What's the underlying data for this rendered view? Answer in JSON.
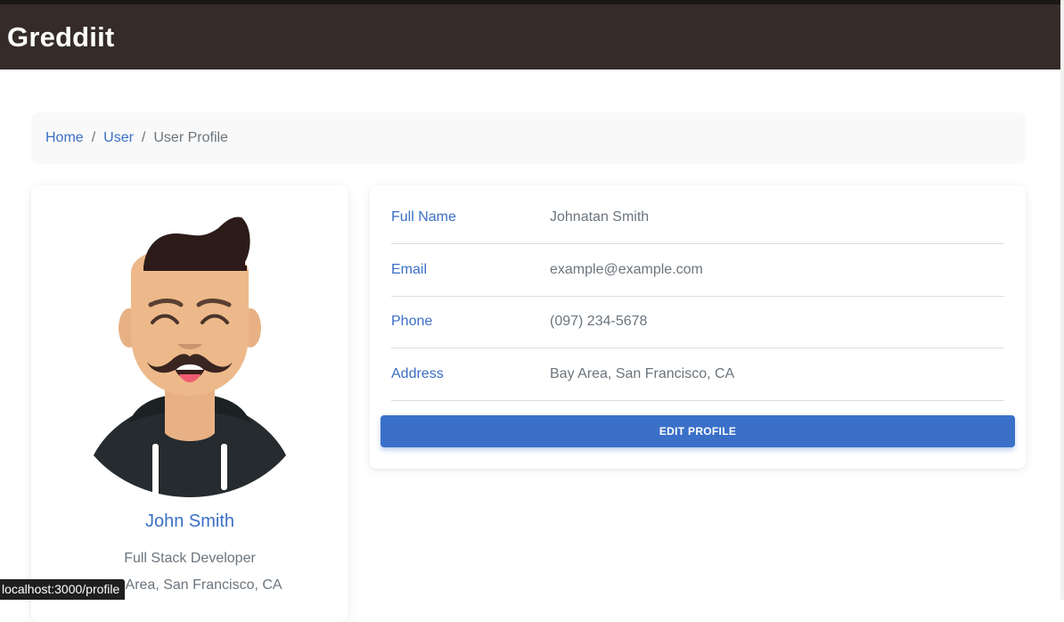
{
  "app": {
    "brand": "Greddiit"
  },
  "breadcrumb": {
    "home": "Home",
    "separator": "/",
    "user": "User",
    "current": "User Profile"
  },
  "profile": {
    "name": "John Smith",
    "role": "Full Stack Developer",
    "location": "Bay Area, San Francisco, CA",
    "avatar_icon": "avatar-illustration"
  },
  "details": [
    {
      "label": "Full Name",
      "value": "Johnatan Smith"
    },
    {
      "label": "Email",
      "value": "example@example.com"
    },
    {
      "label": "Phone",
      "value": "(097) 234-5678"
    },
    {
      "label": "Address",
      "value": "Bay Area, San Francisco, CA"
    }
  ],
  "actions": {
    "edit_profile": "EDIT PROFILE"
  },
  "status_bar": {
    "url": "localhost:3000/profile"
  },
  "colors": {
    "navbar": "#352c2a",
    "accent": "#3b6fc5",
    "button": "#3b70c9",
    "muted_text": "#6c757d"
  }
}
